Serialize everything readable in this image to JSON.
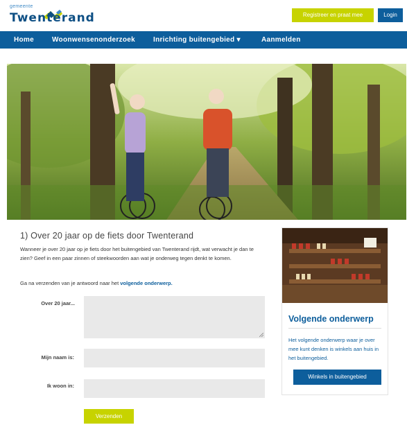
{
  "header": {
    "logo_small": "gemeente",
    "logo_main": "Twenterand",
    "register_label": "Registreer en praat mee",
    "login_label": "Login"
  },
  "nav": {
    "items": [
      {
        "label": "Home"
      },
      {
        "label": "Woonwensenonderzoek"
      },
      {
        "label": "Inrichting buitengebied ▾"
      },
      {
        "label": "Aanmelden"
      }
    ]
  },
  "main": {
    "title": "1) Over 20 jaar op de fiets door Twenterand",
    "intro": "Wanneer je over 20 jaar op je fiets door het buitengebied van Twenterand rijdt, wat verwacht je dan te zien? Geef in een paar zinnen of steekwoorden aan wat je onderweg tegen denkt te komen.",
    "note_prefix": "Ga na verzenden van je antwoord naar het ",
    "note_link": "volgende onderwerp."
  },
  "form": {
    "answer_label": "Over 20 jaar...",
    "answer_value": "",
    "name_label": "Mijn naam is:",
    "name_value": "",
    "town_label": "Ik woon in:",
    "town_value": "",
    "submit_label": "Verzenden"
  },
  "sidebar": {
    "title": "Volgende onderwerp",
    "text": "Het volgende onderwerp waar je over mee kunt denken is winkels aan huis in het buitengebied.",
    "button_label": "Winkels in buitengebied"
  },
  "colors": {
    "brand_blue": "#0d5e9c",
    "accent_lime": "#c7d300"
  }
}
